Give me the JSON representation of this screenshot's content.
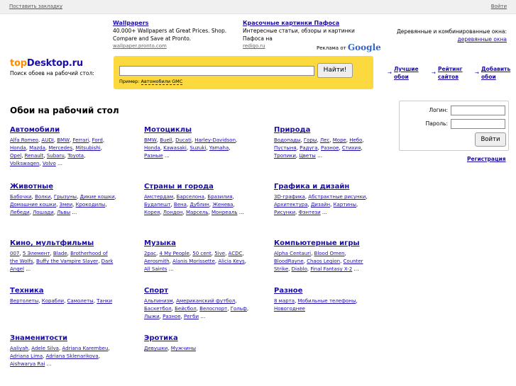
{
  "topbar": {
    "bookmark": "Поставить закладку",
    "login": "Войти"
  },
  "ads": [
    {
      "title": "Wallpapers",
      "text": "40.000+ Wallpapers at Great Prices. Shop. Compare and Save at Pronto.",
      "url": "wallpaper.pronto.com"
    },
    {
      "title": "Красочные картинки Пафоса",
      "text": "Интересные статьи, обзоры и картинки Пафоса на",
      "url": "redigo.ru"
    }
  ],
  "ads_by_prefix": "Реклама от",
  "ads_by_brand": "Google",
  "ad_right": {
    "text": "Деревянные и комбинированные окна:",
    "link": "деревянные окна"
  },
  "logo": {
    "part1": "top",
    "part2": "Desktop.ru",
    "subtitle": "Поиск обоев на рабочий стол:"
  },
  "search": {
    "value": "",
    "button": "Найти!",
    "example_prefix": "Пример:",
    "example": "Автомобили GMC"
  },
  "rnav": [
    {
      "line1": "Лучшие",
      "line2": "обои"
    },
    {
      "line1": "Рейтинг",
      "line2": "сайтов"
    },
    {
      "line1": "Добавить",
      "line2": "обои"
    }
  ],
  "page_title": "Обои на рабочий стол",
  "categories": [
    {
      "title": "Автомобили",
      "items": [
        "Alfa Romeo",
        "AUDI",
        "BMW",
        "Ferrari",
        "Ford",
        "Honda",
        "Mazda",
        "Mercedes",
        "Mitsubishi",
        "Opel",
        "Renault",
        "Subaru",
        "Toyota",
        "Volkswagen",
        "Volvo"
      ]
    },
    {
      "title": "Мотоциклы",
      "items": [
        "BMW",
        "Buell",
        "Ducati",
        "Harley-Davidson",
        "Honda",
        "Kawasaki",
        "Suzuki",
        "Yamaha",
        "Разные"
      ]
    },
    {
      "title": "Природа",
      "items": [
        "Водопады",
        "Горы",
        "Лес",
        "Море",
        "Небо",
        "Пустыня",
        "Радуга",
        "Разное",
        "Стихия",
        "Тропики",
        "Цветы"
      ]
    },
    {
      "title": "Животные",
      "items": [
        "Бабочки",
        "Волки",
        "Грызуны",
        "Дикие кошки",
        "Домашние кошки",
        "Змеи",
        "Крокодилы",
        "Лебеди",
        "Лошади",
        "Львы"
      ]
    },
    {
      "title": "Страны и города",
      "items": [
        "Амстердам",
        "Барселона",
        "Бразилия",
        "Будапешт",
        "Вена",
        "Дублин",
        "Женева",
        "Корея",
        "Лондон",
        "Марсель",
        "Монреаль"
      ]
    },
    {
      "title": "Графика и дизайн",
      "items": [
        "3D-графика",
        "Абстрактные рисунки",
        "Архитектура",
        "Дизайн",
        "Картины",
        "Рисунки",
        "Фэнтези"
      ]
    },
    {
      "title": "Кино, мультфильмы",
      "items": [
        "007",
        "5 Элемент",
        "Blade",
        "Brotherhood of the Wolfs",
        "Buffy the Vampire Slayer",
        "Dark Angel"
      ]
    },
    {
      "title": "Музыка",
      "items": [
        "2pac",
        "4 My People",
        "50 cent",
        "5ive",
        "ACDC",
        "Aerosmith",
        "Alanis Morissette",
        "Alicia Keys",
        "All Saints"
      ]
    },
    {
      "title": "Компьютерные игры",
      "items": [
        "Alpha Centauri",
        "Blood Omen",
        "BloodRayne",
        "Chaos Legion",
        "Counter Strike",
        "Diablo",
        "Final Fantasy X-2"
      ]
    },
    {
      "title": "Техника",
      "items": [
        "Вертолеты",
        "Корабли",
        "Самолеты",
        "Танки"
      ]
    },
    {
      "title": "Спорт",
      "items": [
        "Альпинизм",
        "Американский футбол",
        "Баскетбол",
        "Бейсбол",
        "Велоспорт",
        "Гольф",
        "Лыжи",
        "Разное",
        "Регби"
      ]
    },
    {
      "title": "Разное",
      "items": [
        "8 марта",
        "Мобильные телефоны",
        "Новогоднее"
      ]
    },
    {
      "title": "Знаменитости",
      "items": [
        "Aaliyah",
        "Adele Silva",
        "Adriana Karembeu",
        "Adriana Lima",
        "Adriana Sklenarikova",
        "Aishwarya Rai"
      ]
    },
    {
      "title": "Эротика",
      "items": [
        "Девушки",
        "Мужчины"
      ]
    }
  ],
  "login_box": {
    "login_label": "Логин:",
    "password_label": "Пароль:",
    "button": "Войти",
    "register": "Регистрация"
  }
}
